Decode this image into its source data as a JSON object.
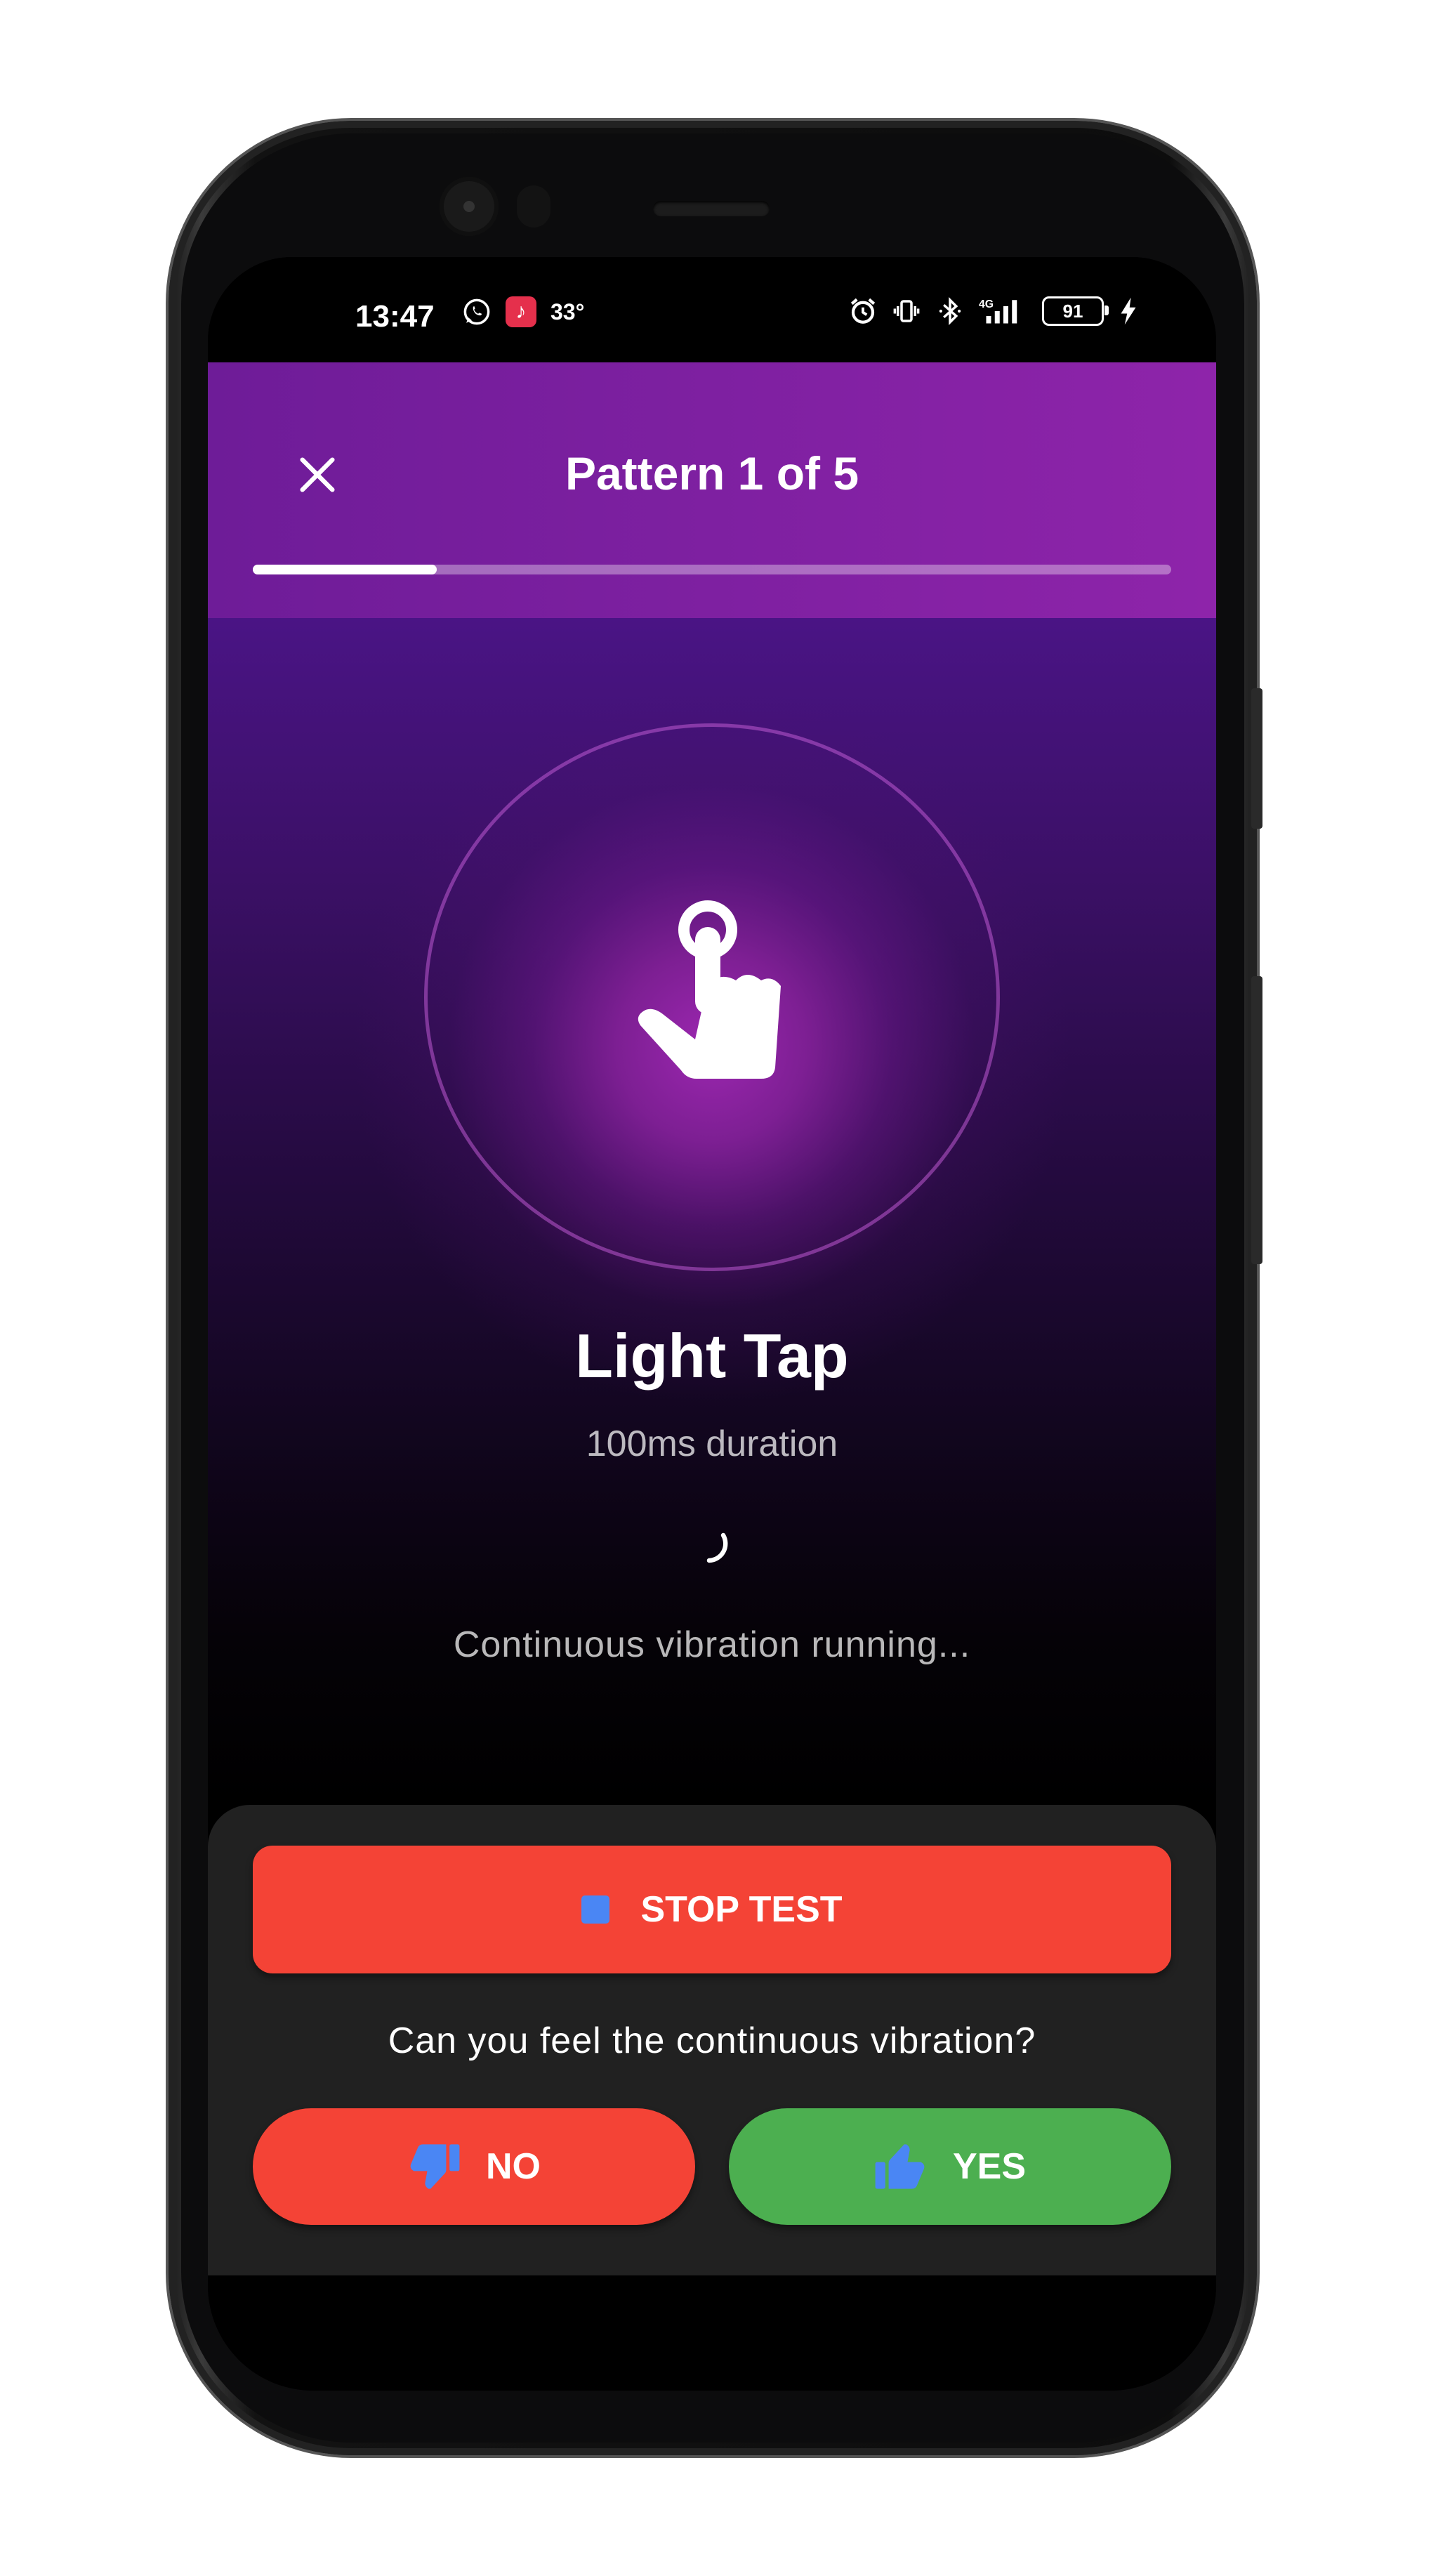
{
  "status_bar": {
    "time": "13:47",
    "temperature": "33°",
    "battery": "91",
    "left_icons": [
      "whatsapp-icon",
      "music-app-icon"
    ],
    "right_icons": [
      "alarm-icon",
      "vibrate-icon",
      "bluetooth-icon",
      "4g-signal-icon",
      "battery-icon",
      "charging-icon"
    ]
  },
  "app_bar": {
    "title": "Pattern 1 of 5",
    "progress_fraction": 0.2
  },
  "pattern": {
    "icon": "tap-hand-icon",
    "name": "Light Tap",
    "duration": "100ms duration",
    "status": "Continuous vibration running..."
  },
  "controls": {
    "stop_label": "STOP TEST",
    "question": "Can you feel the continuous vibration?",
    "no_label": "NO",
    "yes_label": "YES"
  },
  "colors": {
    "app_bar": "#8e24aa",
    "stop": "#f44336",
    "no": "#f44336",
    "yes": "#4caf50",
    "button_icon": "#4a86f4"
  }
}
